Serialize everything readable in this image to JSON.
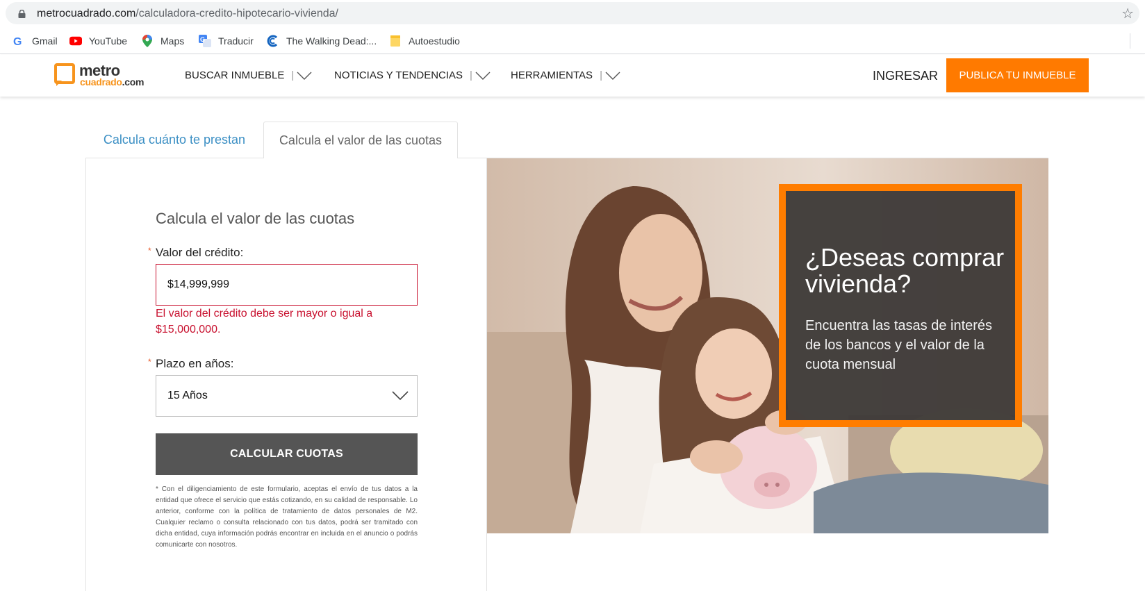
{
  "browser": {
    "url_domain": "metrocuadrado.com",
    "url_path": "/calculadora-credito-hipotecario-vivienda/",
    "bookmarks": [
      {
        "label": "Gmail",
        "icon": "gmail-icon"
      },
      {
        "label": "YouTube",
        "icon": "youtube-icon"
      },
      {
        "label": "Maps",
        "icon": "maps-icon"
      },
      {
        "label": "Traducir",
        "icon": "translate-icon"
      },
      {
        "label": "The Walking Dead:...",
        "icon": "walking-dead-icon"
      },
      {
        "label": "Autoestudio",
        "icon": "folder-icon"
      }
    ]
  },
  "header": {
    "logo_top": "metro",
    "logo_bottom_brand": "cuadrado",
    "logo_bottom_tld": ".com",
    "nav": [
      {
        "label": "BUSCAR INMUEBLE"
      },
      {
        "label": "NOTICIAS Y TENDENCIAS"
      },
      {
        "label": "HERRAMIENTAS"
      }
    ],
    "nav_separator": "|",
    "login": "INGRESAR",
    "publish": "PUBLICA TU INMUEBLE",
    "accent_color": "#ff7a00"
  },
  "tabs": {
    "tab1": "Calcula cuánto te prestan",
    "tab2": "Calcula el valor de las cuotas"
  },
  "form": {
    "title": "Calcula el valor de las cuotas",
    "required_mark": "*",
    "credit_label": "Valor del crédito:",
    "credit_value": "$14,999,999",
    "error": "El valor del crédito debe ser mayor o igual a $15,000,000.",
    "term_label": "Plazo en años:",
    "term_value": "15 Años",
    "submit": "CALCULAR CUOTAS",
    "disclaimer": "* Con el diligenciamiento de este formulario, aceptas el envío de tus datos a la entidad que ofrece el servicio que estás cotizando, en su calidad de responsable. Lo anterior, conforme con la política de tratamiento de datos personales de M2. Cualquier reclamo o consulta relacionado con tus datos, podrá ser tramitado con dicha entidad, cuya información podrás encontrar en incluida en el anuncio o podrás comunicarte con nosotros."
  },
  "promo": {
    "title": "¿Deseas comprar vivienda?",
    "text": "Encuentra las tasas de interés de los bancos y el valor de la cuota mensual"
  }
}
